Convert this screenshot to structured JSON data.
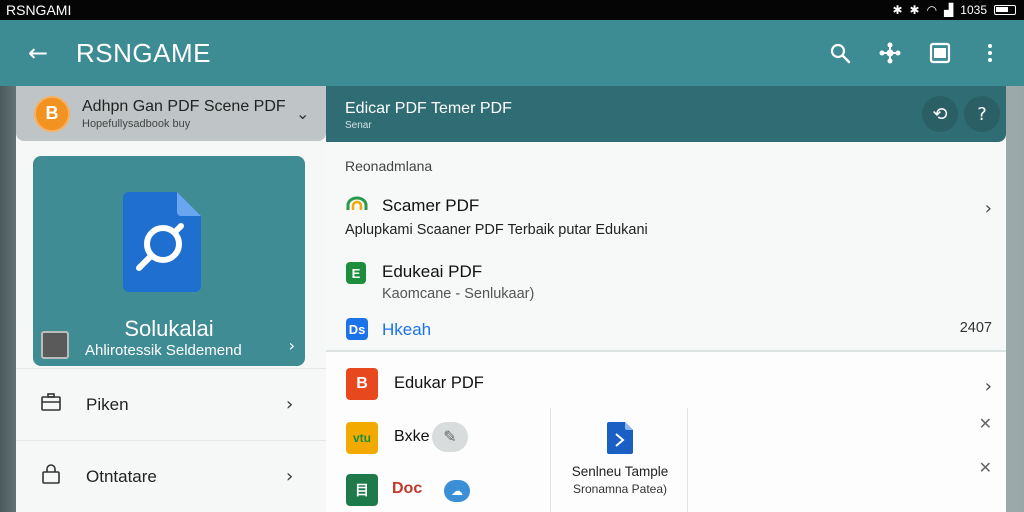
{
  "status": {
    "carrier": "RSNGAMI",
    "time": "1035"
  },
  "appbar": {
    "title": "RSNGAME"
  },
  "account": {
    "avatar_letter": "B",
    "name": "Adhpn Gan PDF Scene PDF",
    "subtitle": "Hopefullysadbook buy"
  },
  "featured": {
    "title": "Solukalai",
    "subtitle": "Ahlirotessik Seldemend"
  },
  "left_menu": [
    {
      "label": "Piken",
      "icon": "briefcase-icon"
    },
    {
      "label": "Otntatare",
      "icon": "lock-icon"
    }
  ],
  "right_header": {
    "title": "Edicar PDF Temer PDF",
    "subtitle": "Senar"
  },
  "section_label": "Reonadmlana",
  "items": [
    {
      "title": "Scamer PDF",
      "subtitle": "Aplupkami Scaaner PDF Terbaik putar Edukani",
      "icon": "scanner-app-icon",
      "color": "#2a9a4a"
    },
    {
      "title": "Edukeai PDF",
      "subtitle": "Kaomcane - Senlukaar)",
      "icon": "sheets-app-icon",
      "color": "#1e8e3e"
    },
    {
      "title": "Hkeah",
      "value": "2407",
      "icon": "docs-app-icon",
      "color": "#1a73e8"
    }
  ],
  "lower": {
    "item_title": "Edukar PDF",
    "row2_label": "Bxke",
    "row3_label": "Doc",
    "card_title": "Senlneu Tample",
    "card_subtitle": "Sronamna Patea)"
  },
  "colors": {
    "appbar": "#3d8b93",
    "accent_dark": "#2f6c74",
    "orange": "#f29220"
  }
}
